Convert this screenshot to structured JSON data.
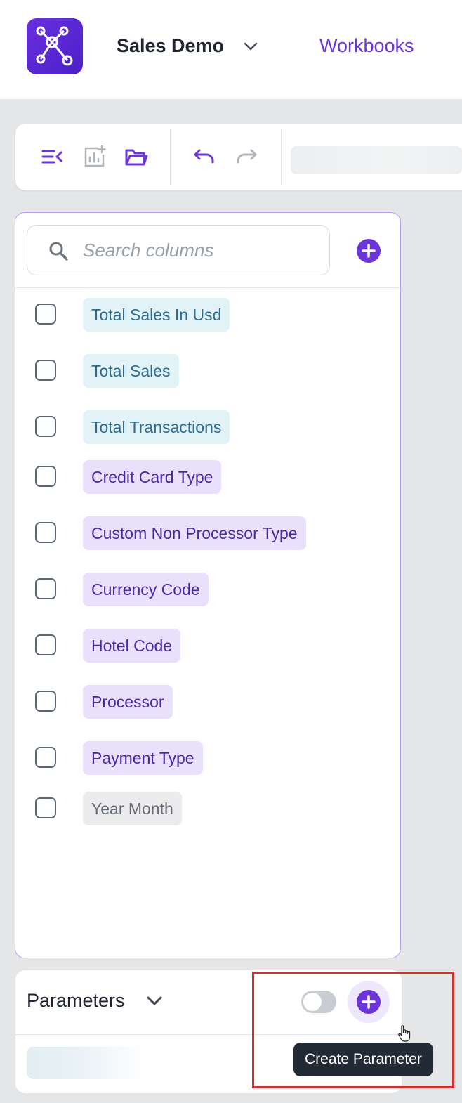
{
  "header": {
    "workspace_name": "Sales Demo",
    "nav_link": "Workbooks",
    "brand_color": "#6b35d8"
  },
  "toolbar": {
    "icons": [
      "collapse-sidebar-icon",
      "add-chart-icon",
      "open-folder-icon",
      "undo-icon",
      "redo-icon"
    ]
  },
  "columns_panel": {
    "search_placeholder": "Search columns",
    "columns": [
      {
        "label": "Total Sales In Usd",
        "kind": "measure",
        "checked": false
      },
      {
        "label": "Total Sales",
        "kind": "measure",
        "checked": false
      },
      {
        "label": "Total Transactions",
        "kind": "measure",
        "checked": false
      },
      {
        "label": "Credit Card Type",
        "kind": "dimension",
        "checked": false
      },
      {
        "label": "Custom Non Processor Type",
        "kind": "dimension",
        "checked": false
      },
      {
        "label": "Currency Code",
        "kind": "dimension",
        "checked": false
      },
      {
        "label": "Hotel Code",
        "kind": "dimension",
        "checked": false
      },
      {
        "label": "Processor",
        "kind": "dimension",
        "checked": false
      },
      {
        "label": "Payment Type",
        "kind": "dimension",
        "checked": false
      },
      {
        "label": "Year Month",
        "kind": "date",
        "checked": false
      }
    ]
  },
  "parameters_panel": {
    "title": "Parameters",
    "toggle_on": false,
    "tooltip": "Create Parameter"
  },
  "colors": {
    "measure_bg": "#e2f3f8",
    "measure_text": "#2d6c91",
    "dimension_bg": "#e9e0fb",
    "dimension_text": "#4a2aa0",
    "date_bg": "#ececee",
    "date_text": "#646b75",
    "highlight": "#d32f2f"
  }
}
